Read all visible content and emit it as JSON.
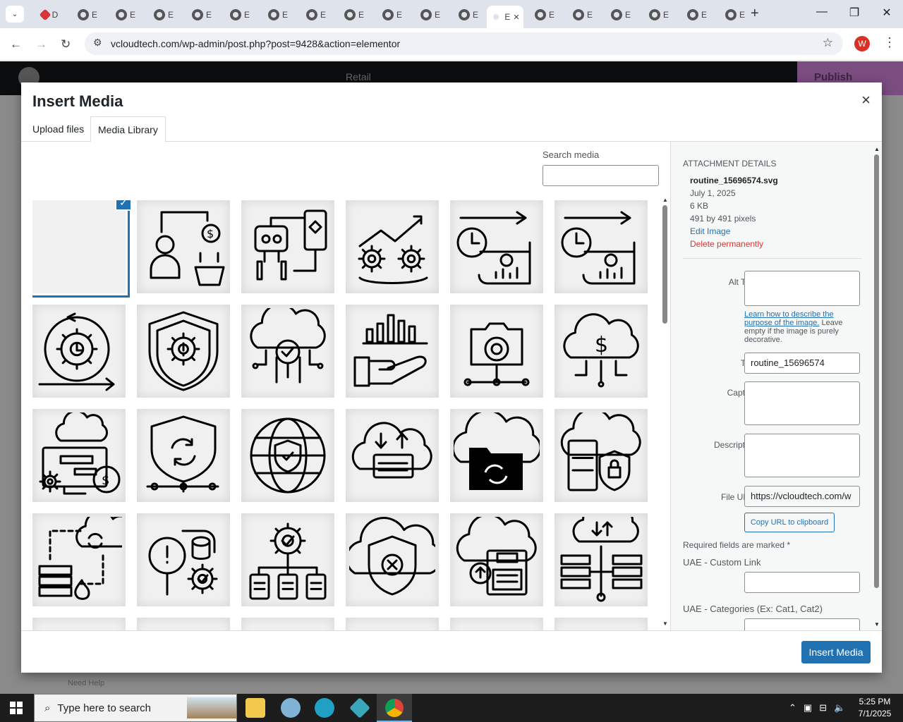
{
  "browser": {
    "tabs": [
      {
        "label": "D"
      },
      {
        "label": "E"
      },
      {
        "label": "E"
      },
      {
        "label": "E"
      },
      {
        "label": "E"
      },
      {
        "label": "E"
      },
      {
        "label": "E"
      },
      {
        "label": "E"
      },
      {
        "label": "E"
      },
      {
        "label": "E"
      },
      {
        "label": "E"
      },
      {
        "label": "E"
      },
      {
        "label": "E"
      },
      {
        "label": "E"
      },
      {
        "label": "E"
      },
      {
        "label": "E"
      },
      {
        "label": "E"
      },
      {
        "label": "E"
      },
      {
        "label": "E"
      }
    ],
    "active_tab_label": "E",
    "url": "vcloudtech.com/wp-admin/post.php?post=9428&action=elementor",
    "profile_initial": "W"
  },
  "editor": {
    "retail_label": "Retail",
    "publish_label": "Publish",
    "need_help": "Need Help"
  },
  "modal": {
    "title": "Insert Media",
    "close": "×",
    "tabs": {
      "upload": "Upload files",
      "library": "Media Library"
    },
    "search_label": "Search media",
    "search_value": "",
    "items": [
      {
        "icon": "routine-icon",
        "selected": true
      },
      {
        "icon": "customer-shopping-icon"
      },
      {
        "icon": "robot-remote-icon"
      },
      {
        "icon": "gears-growth-icon"
      },
      {
        "icon": "business-plan-icon"
      },
      {
        "icon": "business-plan-icon"
      },
      {
        "icon": "clock-gear-cycle-icon"
      },
      {
        "icon": "shield-gear-warning-icon"
      },
      {
        "icon": "cloud-search-icon"
      },
      {
        "icon": "hand-chart-icon"
      },
      {
        "icon": "network-folder-icon"
      },
      {
        "icon": "cloud-dollar-icon"
      },
      {
        "icon": "cloud-computer-icon"
      },
      {
        "icon": "shield-sync-icon"
      },
      {
        "icon": "globe-shield-icon"
      },
      {
        "icon": "cloud-transfer-icon"
      },
      {
        "icon": "cloud-folder-sync-icon"
      },
      {
        "icon": "cloud-document-lock-icon"
      },
      {
        "icon": "server-cloud-fire-icon"
      },
      {
        "icon": "search-database-icon"
      },
      {
        "icon": "gear-documents-icon"
      },
      {
        "icon": "cloud-shield-x-icon"
      },
      {
        "icon": "cloud-floppy-icon"
      },
      {
        "icon": "cloud-server-network-icon"
      }
    ],
    "details": {
      "header": "ATTACHMENT DETAILS",
      "filename": "routine_15696574.svg",
      "date": "July 1, 2025",
      "size": "6 KB",
      "dimensions": "491 by 491 pixels",
      "edit": "Edit Image",
      "delete": "Delete permanently",
      "alt_label": "Alt Text",
      "alt_value": "",
      "help_link": "Learn how to describe the purpose of the image.",
      "help_rest": " Leave empty if the image is purely decorative.",
      "title_label": "Title",
      "title_value": "routine_15696574",
      "caption_label": "Caption",
      "caption_value": "",
      "description_label": "Description",
      "description_value": "",
      "fileurl_label": "File URL:",
      "fileurl_value": "https://vcloudtech.com/w",
      "copy_label": "Copy URL to clipboard",
      "required": "Required fields are marked *",
      "uae_link": "UAE - Custom Link",
      "uae_link_value": "",
      "uae_cat": "UAE - Categories (Ex: Cat1, Cat2)"
    },
    "insert_label": "Insert Media"
  },
  "taskbar": {
    "search_placeholder": "Type here to search",
    "time": "5:25 PM",
    "date": "7/1/2025"
  },
  "colors": {
    "accent": "#2271b1",
    "danger": "#d63638",
    "publish": "#7a4c80"
  }
}
